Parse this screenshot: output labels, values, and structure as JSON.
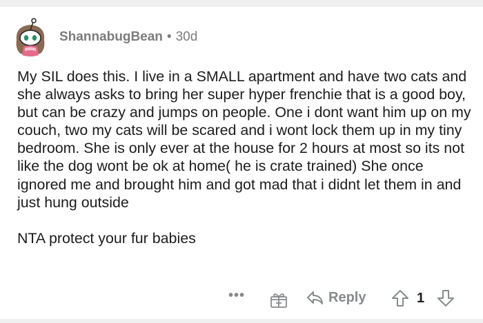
{
  "comment": {
    "username": "ShannabugBean",
    "separator": "•",
    "age": "30d",
    "paragraphs": [
      "My SIL does this. I live in a SMALL apartment and have two cats and she always asks to bring her super hyper frenchie that is a good boy, but can be crazy and jumps on people.  One i dont want him up on my couch, two my cats will be scared and i wont lock them up in my tiny bedroom. She is only ever at the house for 2 hours at most so its not like the dog wont be ok at home( he is crate trained) She once ignored me and brought him and got mad that i didnt let them in and just hung outside",
      "NTA protect your fur babies"
    ]
  },
  "actions": {
    "more_label": "•••",
    "reply_label": "Reply",
    "score": "1"
  },
  "icons": {
    "avatar": "snoo-avatar",
    "award": "gift-icon",
    "reply": "reply-arrow-icon",
    "upvote": "upvote-arrow-icon",
    "downvote": "downvote-arrow-icon"
  },
  "colors": {
    "text": "#1c1c1c",
    "muted": "#7c7c7c",
    "icon": "#878a8c"
  }
}
